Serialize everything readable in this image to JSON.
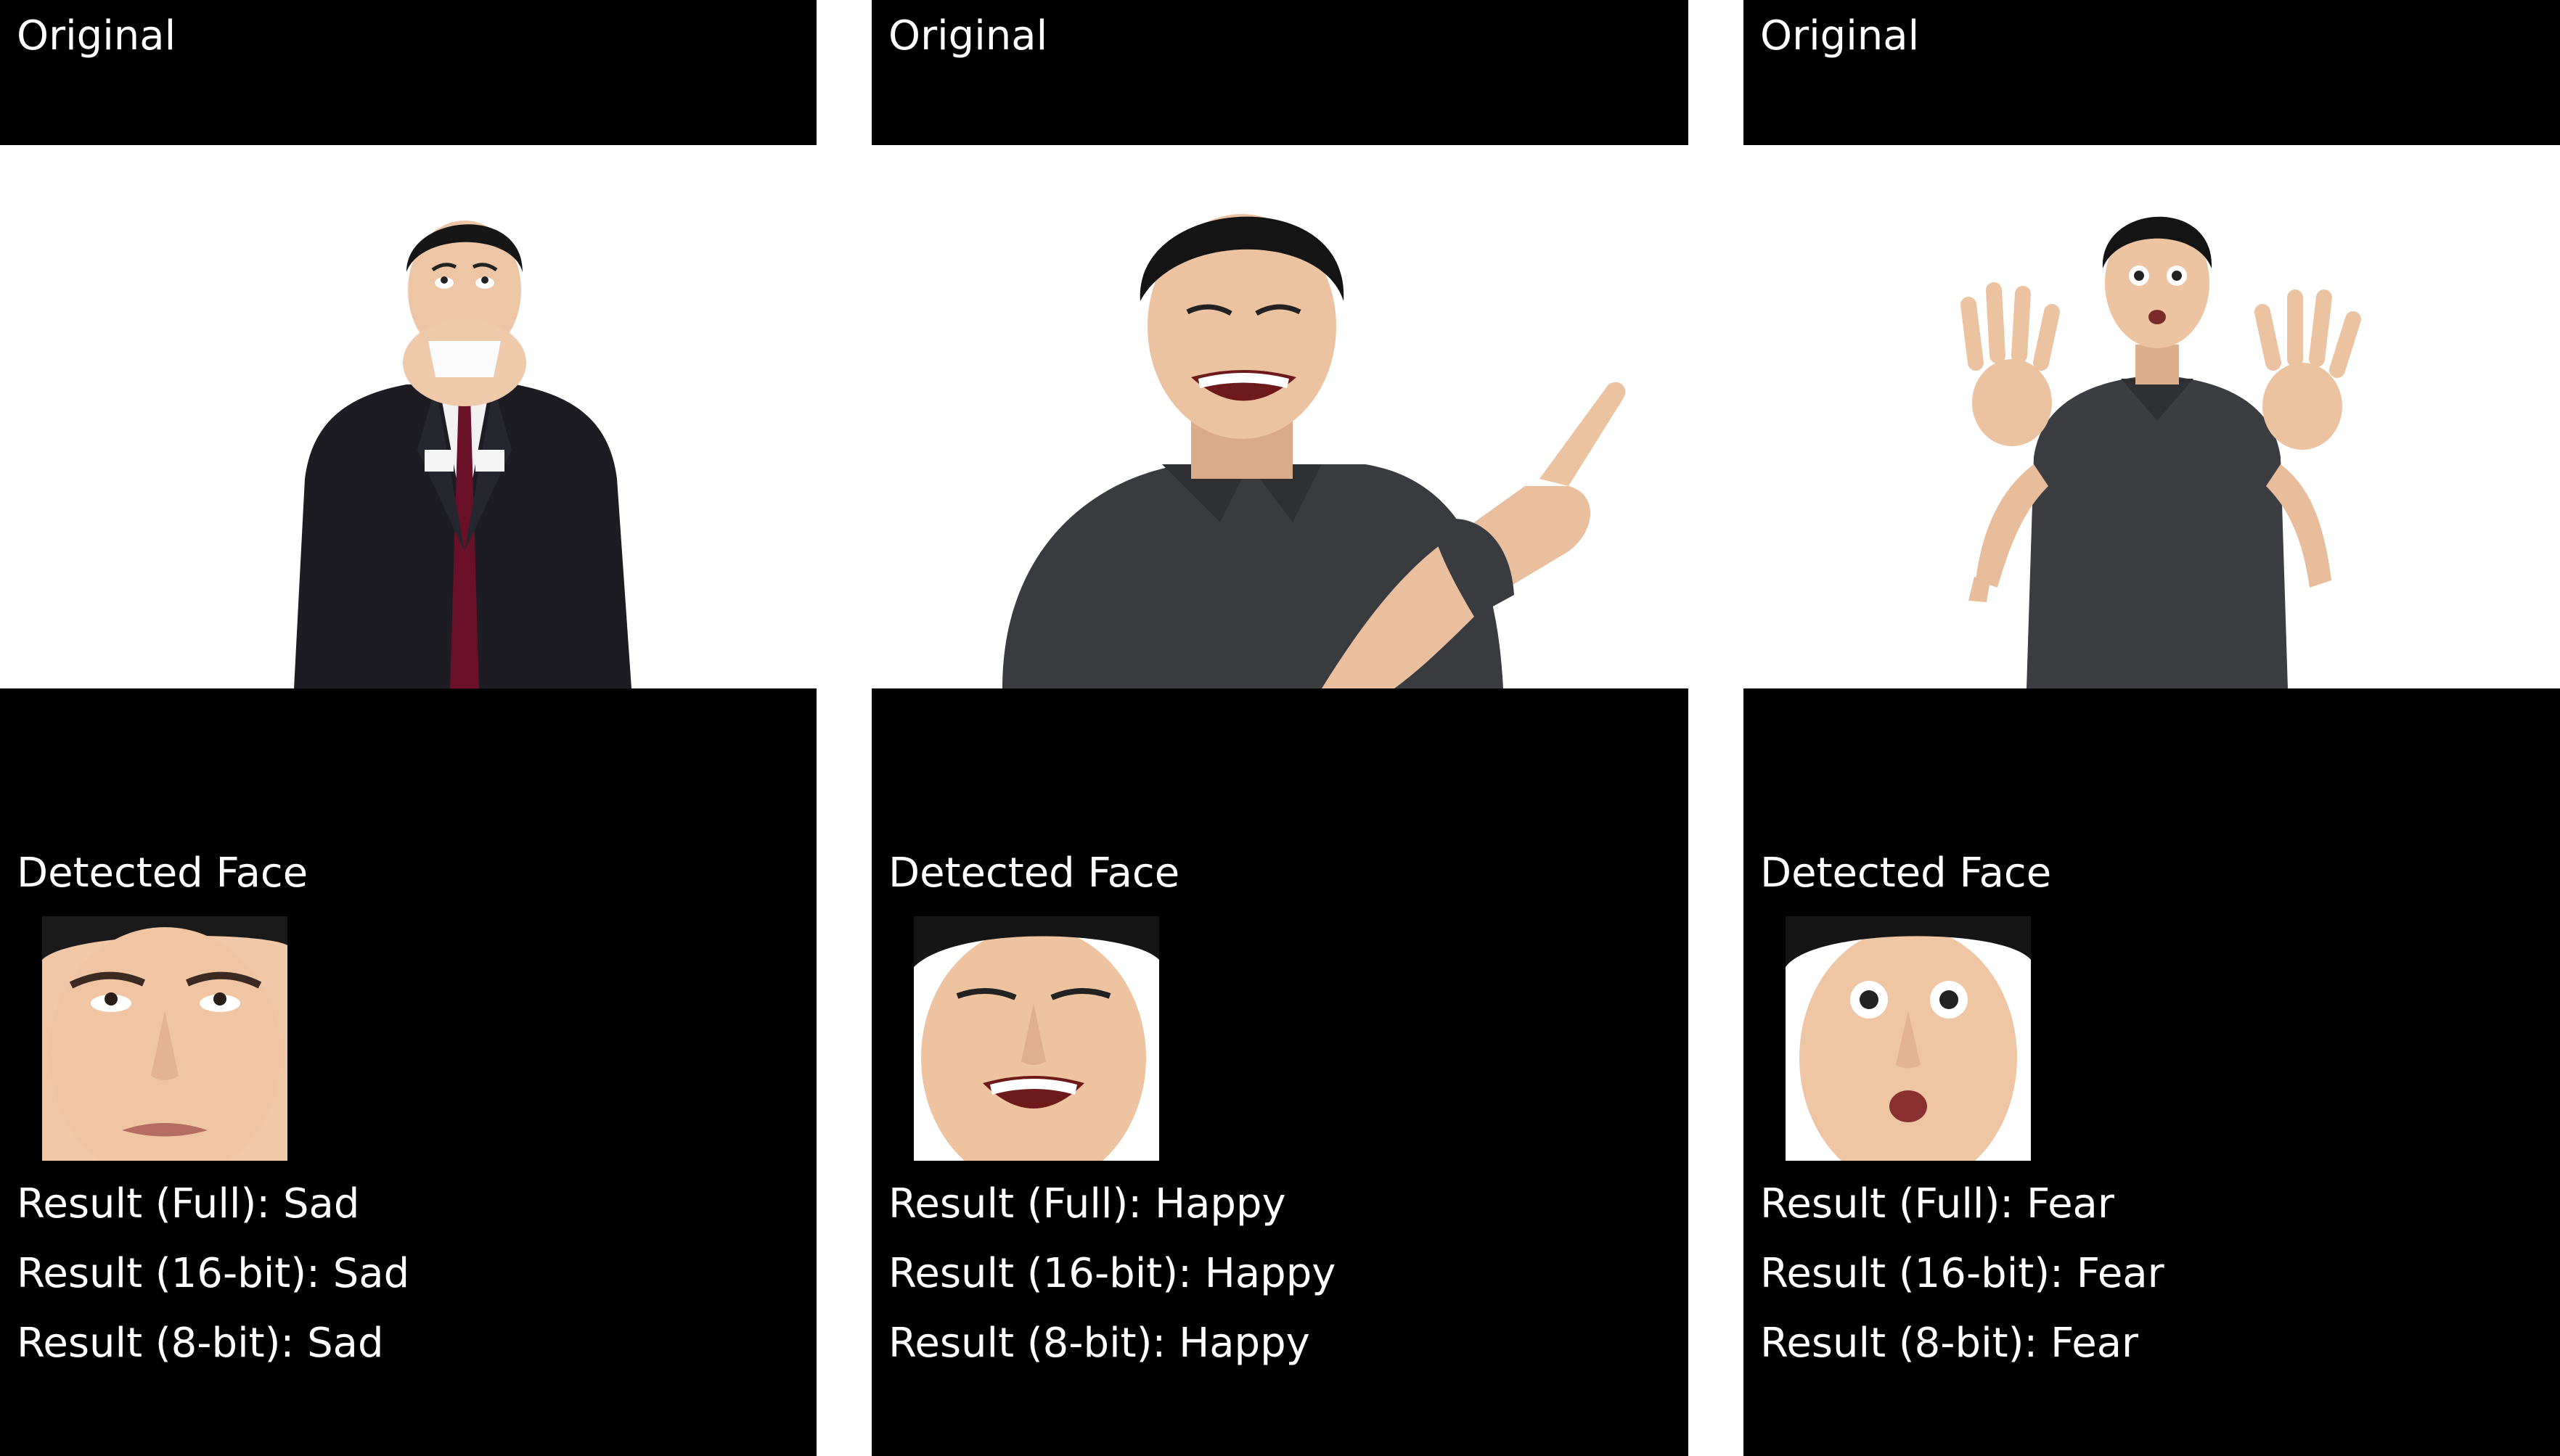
{
  "panels": [
    {
      "original_label": "Original",
      "detected_label": "Detected Face",
      "photo": "man-in-suit-wiping-tears-with-tissue",
      "face_crop": "sad-face-crop",
      "results": [
        {
          "label": "Result (Full): Sad"
        },
        {
          "label": "Result (16-bit): Sad"
        },
        {
          "label": "Result (8-bit): Sad"
        }
      ]
    },
    {
      "original_label": "Original",
      "detected_label": "Detected Face",
      "photo": "man-laughing-and-pointing",
      "face_crop": "happy-face-crop",
      "results": [
        {
          "label": "Result (Full): Happy"
        },
        {
          "label": "Result (16-bit): Happy"
        },
        {
          "label": "Result (8-bit): Happy"
        }
      ]
    },
    {
      "original_label": "Original",
      "detected_label": "Detected Face",
      "photo": "man-surprised-hands-raised",
      "face_crop": "fear-face-crop",
      "results": [
        {
          "label": "Result (Full): Fear"
        },
        {
          "label": "Result (16-bit): Fear"
        },
        {
          "label": "Result (8-bit): Fear"
        }
      ]
    }
  ],
  "colors": {
    "screen_background": "#000000",
    "text": "#ffffff",
    "gutter": "#ffffff",
    "photo_background": "#ffffff"
  }
}
